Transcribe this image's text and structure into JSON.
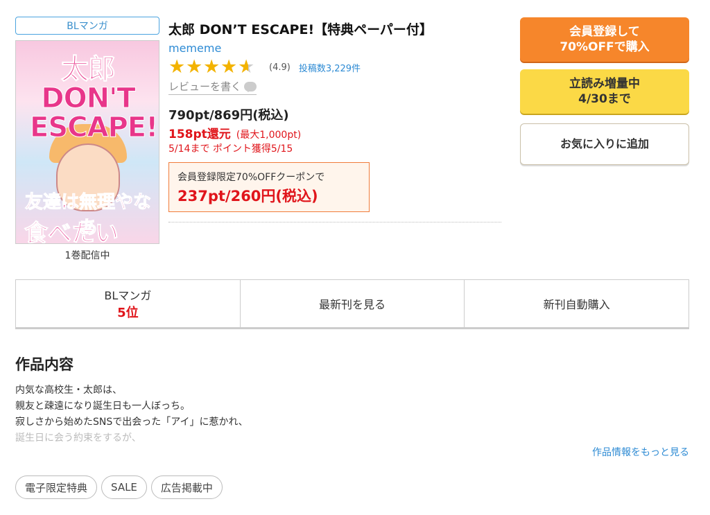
{
  "product": {
    "genre_tag": "BLマンガ",
    "cover_title_art": "太郎 DON'T ESCAPE!",
    "cover_bottom_art1": "友達は無理やなあ",
    "cover_bottom_art2": "食べたい",
    "volumes": "1巻配信中",
    "title": "太郎 DON’T ESCAPE!【特典ペーパー付】",
    "author": "mememe",
    "rating": {
      "stars_value": 4.5,
      "score": "(4.9)",
      "review_count": "投稿数3,229件",
      "write_review": "レビューを書く"
    },
    "price": "790pt/869円(税込)",
    "points_back": "158pt還元",
    "points_max": "(最大1,000pt)",
    "deadline": "5/14まで ポイント獲得5/15",
    "coupon": {
      "label": "会員登録限定70%OFFクーポンで",
      "price": "237pt/260円(税込)"
    }
  },
  "buttons": {
    "register_line1": "会員登録して",
    "register_line2": "70%OFFで購入",
    "preview_line1": "立読み増量中",
    "preview_line2": "4/30まで",
    "favorite": "お気に入りに追加"
  },
  "stats": {
    "genre": "BLマンガ",
    "rank": "5位",
    "latest": "最新刊を見る",
    "auto_buy": "新刊自動購入"
  },
  "description": {
    "heading": "作品内容",
    "lines": [
      "内気な高校生・太郎は、",
      "親友と疎遠になり誕生日も一人ぼっち。",
      "寂しさから始めたSNSで出会った「アイ」に惹かれ、",
      "誕生日に会う約束をするが、"
    ],
    "more": "作品情報をもっと見る"
  },
  "tags": [
    "電子限定特典",
    "SALE",
    "広告掲載中"
  ],
  "colors": {
    "accent_blue": "#2e8bd4",
    "price_red": "#e0151b",
    "register_orange": "#f6862b",
    "preview_yellow": "#fbd946",
    "star_gold": "#f3b300"
  }
}
